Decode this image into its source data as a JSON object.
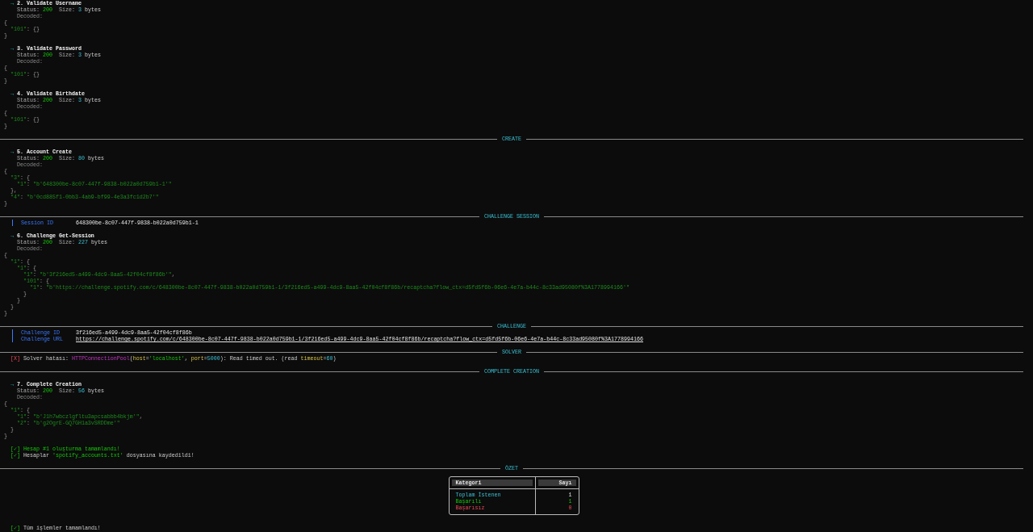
{
  "log": [
    {
      "kind": "request",
      "bullet": "→",
      "title": "2. Validate Username",
      "status_label": "Status:",
      "status": "200",
      "size_label": "Size:",
      "size": "3",
      "unit": "bytes",
      "decoded_label": "Decoded:",
      "body": [
        "{",
        "  \"101\": {}",
        "}"
      ]
    },
    {
      "kind": "request",
      "bullet": "→",
      "title": "3. Validate Password",
      "status_label": "Status:",
      "status": "200",
      "size_label": "Size:",
      "size": "3",
      "unit": "bytes",
      "decoded_label": "Decoded:",
      "body": [
        "{",
        "  \"101\": {}",
        "}"
      ]
    },
    {
      "kind": "request",
      "bullet": "→",
      "title": "4. Validate Birthdate",
      "status_label": "Status:",
      "status": "200",
      "size_label": "Size:",
      "size": "3",
      "unit": "bytes",
      "decoded_label": "Decoded:",
      "body": [
        "{",
        "  \"101\": {}",
        "}"
      ]
    },
    {
      "kind": "rule",
      "label": "CREATE"
    },
    {
      "kind": "request",
      "bullet": "→",
      "title": "5. Account Create",
      "status_label": "Status:",
      "status": "200",
      "size_label": "Size:",
      "size": "80",
      "unit": "bytes",
      "decoded_label": "Decoded:",
      "body": [
        "{",
        "  \"3\": {",
        "    \"1\": \"b'648300be-8c07-447f-9838-b022a0d759b1-1'\"",
        "  },",
        "  \"4\": \"b'0cd885f1-0bb3-4ab9-bf99-4e3a3fc1d2b7'\"",
        "}"
      ]
    },
    {
      "kind": "rule",
      "label": "CHALLENGE SESSION"
    },
    {
      "kind": "fields",
      "rows": [
        {
          "key": "Session ID",
          "value": "648300be-8c07-447f-9838-b022a0d759b1-1",
          "link": false
        }
      ]
    },
    {
      "kind": "request",
      "bullet": "→",
      "title": "6. Challenge Get-Session",
      "status_label": "Status:",
      "status": "200",
      "size_label": "Size:",
      "size": "227",
      "unit": "bytes",
      "decoded_label": "Decoded:",
      "body": [
        "{",
        "  \"1\": {",
        "    \"1\": {",
        "      \"1\": \"b'3f216ed5-a499-4dc9-8aa5-42f04cf8f86b'\",",
        "      \"101\": {",
        "        \"1\": \"b'https://challenge.spotify.com/c/648300be-8c07-447f-9838-b022a0d759b1-1/3f216ed5-a499-4dc9-8aa5-42f04cf8f86b/recaptcha?flow_ctx=d5fd5f6b-06e6-4e7a-b44c-8c33ad95080f%3A1778994166'\"",
        "      }",
        "    }",
        "  }",
        "}"
      ]
    },
    {
      "kind": "rule",
      "label": "CHALLENGE"
    },
    {
      "kind": "fields",
      "rows": [
        {
          "key": "Challenge ID",
          "value": "3f216ed5-a499-4dc9-8aa5-42f04cf8f86b",
          "link": false
        },
        {
          "key": "Challenge URL",
          "value": "https://challenge.spotify.com/c/648300be-8c07-447f-9838-b022a0d759b1-1/3f216ed5-a499-4dc9-8aa5-42f04cf8f86b/recaptcha?flow_ctx=d5fd5f6b-06e6-4e7a-b44c-8c33ad95080f%3A1778994166",
          "link": true
        }
      ]
    },
    {
      "kind": "rule",
      "label": "SOLVER"
    },
    {
      "kind": "error",
      "mark": "[X]",
      "parts": [
        {
          "kind": "plain",
          "text": " Solver hatası: "
        },
        {
          "kind": "class",
          "text": "HTTPConnectionPool"
        },
        {
          "kind": "plain",
          "text": "("
        },
        {
          "kind": "param",
          "text": "host"
        },
        {
          "kind": "plain",
          "text": "="
        },
        {
          "kind": "string",
          "text": "'localhost'"
        },
        {
          "kind": "plain",
          "text": ", "
        },
        {
          "kind": "param",
          "text": "port"
        },
        {
          "kind": "plain",
          "text": "="
        },
        {
          "kind": "number",
          "text": "5000"
        },
        {
          "kind": "plain",
          "text": "): Read timed out. (read "
        },
        {
          "kind": "param",
          "text": "timeout"
        },
        {
          "kind": "plain",
          "text": "="
        },
        {
          "kind": "number",
          "text": "60"
        },
        {
          "kind": "plain",
          "text": ")"
        }
      ]
    },
    {
      "kind": "rule",
      "label": "COMPLETE CREATION"
    },
    {
      "kind": "request",
      "bullet": "→",
      "title": "7. Complete Creation",
      "status_label": "Status:",
      "status": "200",
      "size_label": "Size:",
      "size": "56",
      "unit": "bytes",
      "decoded_label": "Decoded:",
      "body": [
        "{",
        "  \"1\": {",
        "    \"1\": \"b'J1h7wbczlgfltu3apcsabbb4bkjm'\",",
        "    \"2\": \"b'g2OgrE-GQ7GH1a3vSRDDme'\"",
        "  }",
        "}"
      ]
    },
    {
      "kind": "messages",
      "items": [
        {
          "mark": "[✓]",
          "parts": [
            {
              "kind": "success",
              "text": " Hesap #1 oluşturma tamamlandı!"
            }
          ]
        },
        {
          "mark": "[✓]",
          "parts": [
            {
              "kind": "plain",
              "text": " Hesaplar "
            },
            {
              "kind": "string",
              "text": "'spotify_accounts.txt'"
            },
            {
              "kind": "plain",
              "text": " dosyasına kaydedildi!"
            }
          ]
        }
      ]
    },
    {
      "kind": "rule",
      "label": "ÖZET"
    },
    {
      "kind": "table",
      "columns": [
        "Kategori",
        "Sayı"
      ],
      "rows": [
        {
          "kind": "total",
          "label": "Toplam İstenen",
          "value": "1"
        },
        {
          "kind": "success",
          "label": "Başarılı",
          "value": "1"
        },
        {
          "kind": "failure",
          "label": "Başarısız",
          "value": "0"
        }
      ]
    },
    {
      "kind": "final",
      "mark": "[✓]",
      "parts": [
        {
          "kind": "plain",
          "text": " Tüm işlemler tamamlandı!"
        }
      ]
    }
  ]
}
